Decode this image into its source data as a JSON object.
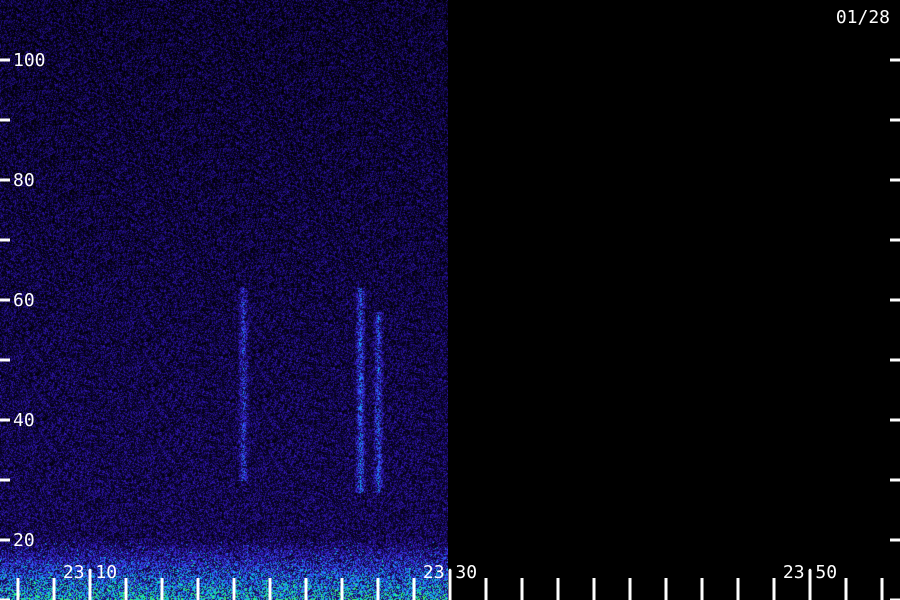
{
  "chart_data": {
    "type": "heatmap",
    "date_label": "01/28",
    "y_axis": {
      "range": [
        10,
        110
      ],
      "labeled_ticks": [
        100,
        80,
        60,
        40,
        20
      ],
      "tick_labels": [
        "100",
        "80",
        "60",
        "40",
        "20"
      ],
      "minor_ticks": [
        90,
        70,
        50,
        30,
        10
      ]
    },
    "x_axis": {
      "range": [
        "23:05",
        "23:55"
      ],
      "labeled_ticks": [
        "23:10",
        "23:30",
        "23:50"
      ],
      "minor_ticks": [
        "23:06",
        "23:08",
        "23:12",
        "23:14",
        "23:16",
        "23:18",
        "23:20",
        "23:22",
        "23:24",
        "23:26",
        "23:28",
        "23:32",
        "23:34",
        "23:36",
        "23:38",
        "23:40",
        "23:42",
        "23:44",
        "23:46",
        "23:48",
        "23:52",
        "23:54"
      ]
    },
    "data_extent": [
      "23:05",
      "23:29.9"
    ],
    "colormap": [
      "#000000",
      "#1a0a6e",
      "#3a1fd0",
      "#2a70ff",
      "#00d4e0",
      "#40ff60"
    ],
    "features": [
      {
        "type": "vertical-streak",
        "time": "23:18.5",
        "freq_range": [
          30,
          62
        ],
        "intensity": 0.35
      },
      {
        "type": "vertical-streak",
        "time": "23:25",
        "freq_range": [
          28,
          62
        ],
        "intensity": 0.45
      },
      {
        "type": "vertical-streak",
        "time": "23:26",
        "freq_range": [
          28,
          58
        ],
        "intensity": 0.4
      },
      {
        "type": "low-freq-band",
        "freq_range": [
          10,
          20
        ],
        "intensity": 0.75
      }
    ]
  }
}
